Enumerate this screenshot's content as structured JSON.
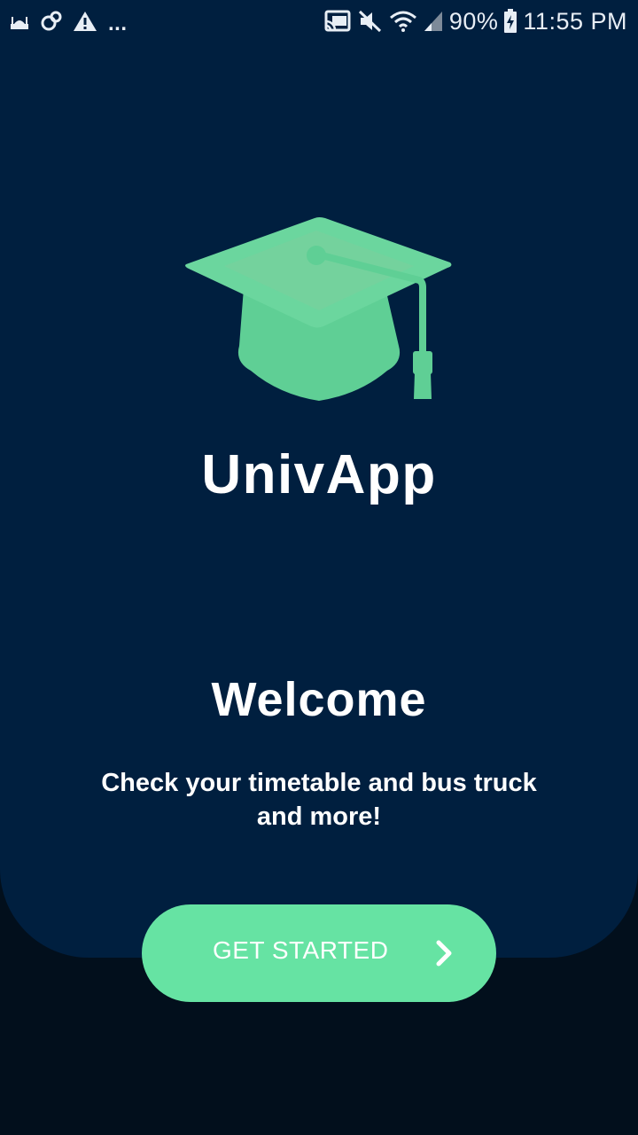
{
  "status_bar": {
    "left_icons": [
      "mosque-notification-icon",
      "sync-icon",
      "warning-icon"
    ],
    "more_indicator": "...",
    "right_icons": [
      "cast-icon",
      "mute-icon",
      "wifi-icon",
      "signal-icon",
      "battery-charging-icon"
    ],
    "battery": "90%",
    "time": "11:55 PM"
  },
  "app": {
    "logo_icon": "graduation-cap-icon",
    "title": "UnivApp"
  },
  "welcome": {
    "title": "Welcome",
    "subtitle": "Check your timetable and bus truck and more!"
  },
  "cta": {
    "label": "GET STARTED",
    "icon": "chevron-right-icon"
  },
  "colors": {
    "panel": "#001f3f",
    "background": "#020f1c",
    "accent": "#66e3a3",
    "text": "#ffffff"
  }
}
